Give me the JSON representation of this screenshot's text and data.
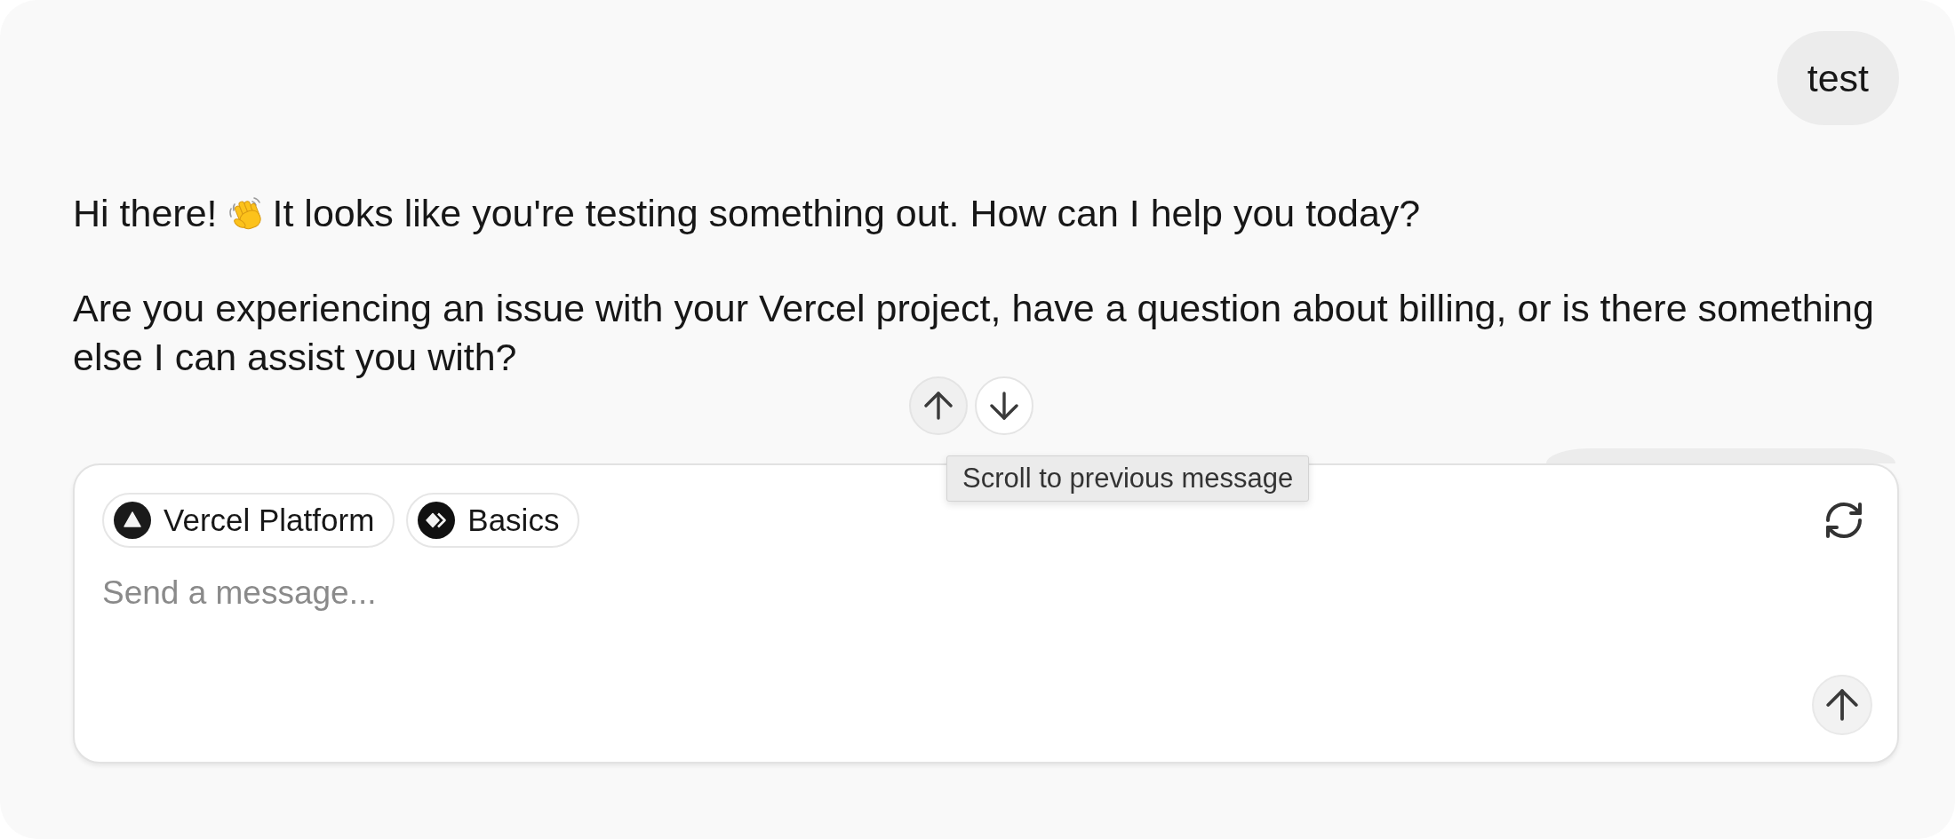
{
  "messages": [
    {
      "kind": "user",
      "text": "test"
    },
    {
      "kind": "assistant",
      "paragraphs": [
        {
          "segments": [
            {
              "kind": "text",
              "text": "Hi there!"
            },
            {
              "kind": "emoji"
            },
            {
              "kind": "text",
              "text": "It looks like you're testing something out. How can I help you today?"
            }
          ]
        },
        {
          "segments": [
            {
              "kind": "text",
              "text": "Are you experiencing an issue with your Vercel project, have a question about billing, or is there something else I can assist you with?"
            }
          ]
        }
      ]
    },
    {
      "kind": "user"
    }
  ],
  "scroll_controls": {
    "buttons": [
      {
        "kind": "up",
        "hovered": true
      },
      {
        "kind": "down",
        "hovered": false
      }
    ],
    "tooltip": "Scroll to previous message"
  },
  "composer": {
    "chips": [
      {
        "label": "Vercel Platform",
        "kind": "triangle"
      },
      {
        "label": "Basics",
        "kind": "diamond"
      }
    ],
    "placeholder": "Send a message..."
  }
}
